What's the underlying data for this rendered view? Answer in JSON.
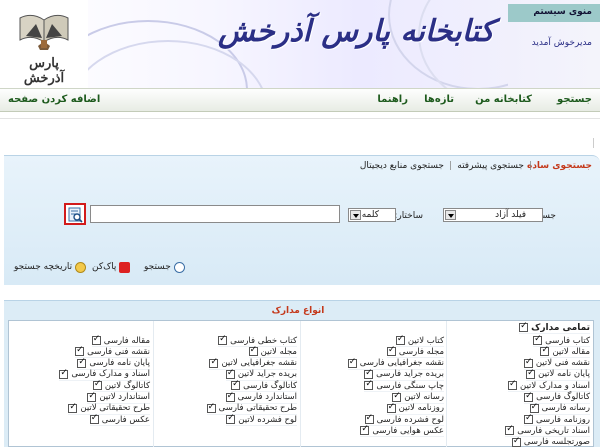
{
  "header": {
    "banner_title": "کتابخانه پارس آذرخش",
    "logo_text": "پارس آذرخش",
    "system_menu_label": "منوی سیستم",
    "welcome_text": "مدیرخوش آمدید"
  },
  "navbar": {
    "items": [
      "جستجو",
      "کتابخانه من",
      "تازه‌ها",
      "راهنما"
    ],
    "homepage_label": "اضافه کردن صفحه"
  },
  "search": {
    "tabs": [
      "جستجوی ساده",
      "جستجوی پیشرفته",
      "جستجوی منابع دیجیتال"
    ],
    "search_in_label": "جستجو در:",
    "field_value": "فیلد آزاد",
    "structure_label": "ساختار:",
    "structure_value": "کلمه",
    "query_value": "",
    "buttons": {
      "search": "جستجو",
      "clear": "پاک‌کن",
      "history": "تاریخچه جستجو"
    }
  },
  "documents": {
    "title": "انواع مدارک",
    "all_label": "تمامی مدارک",
    "columns": [
      [
        "کتاب فارسی",
        "مقاله لاتین",
        "نقشه فنی لاتین",
        "پایان نامه لاتین",
        "اسناد و مدارک لاتین",
        "کاتالوگ فارسی",
        "رسانه فارسی",
        "روزنامه فارسی",
        "اسناد تاریخی فارسی",
        "صورتجلسه فارسی"
      ],
      [
        "کتاب لاتین",
        "مجله فارسی",
        "نقشه جغرافیایی فارسی",
        "بریده جراید فارسی",
        "چاپ سنگی فارسی",
        "رسانه لاتین",
        "روزنامه لاتین",
        "لوح فشرده فارسی",
        "عکس هوایی فارسی"
      ],
      [
        "کتاب خطی فارسی",
        "مجله لاتین",
        "نقشه جغرافیایی لاتین",
        "بریده جراید لاتین",
        "کاتالوگ فارسی",
        "استاندارد فارسی",
        "طرح تحقیقاتی فارسی",
        "لوح فشرده لاتین"
      ],
      [
        "مقاله فارسی",
        "نقشه فنی فارسی",
        "پایان نامه فارسی",
        "اسناد و مدارک فارسی",
        "کاتالوگ لاتین",
        "استاندارد لاتین",
        "طرح تحقیقاتی لاتین",
        "عکس فارسی"
      ]
    ]
  }
}
